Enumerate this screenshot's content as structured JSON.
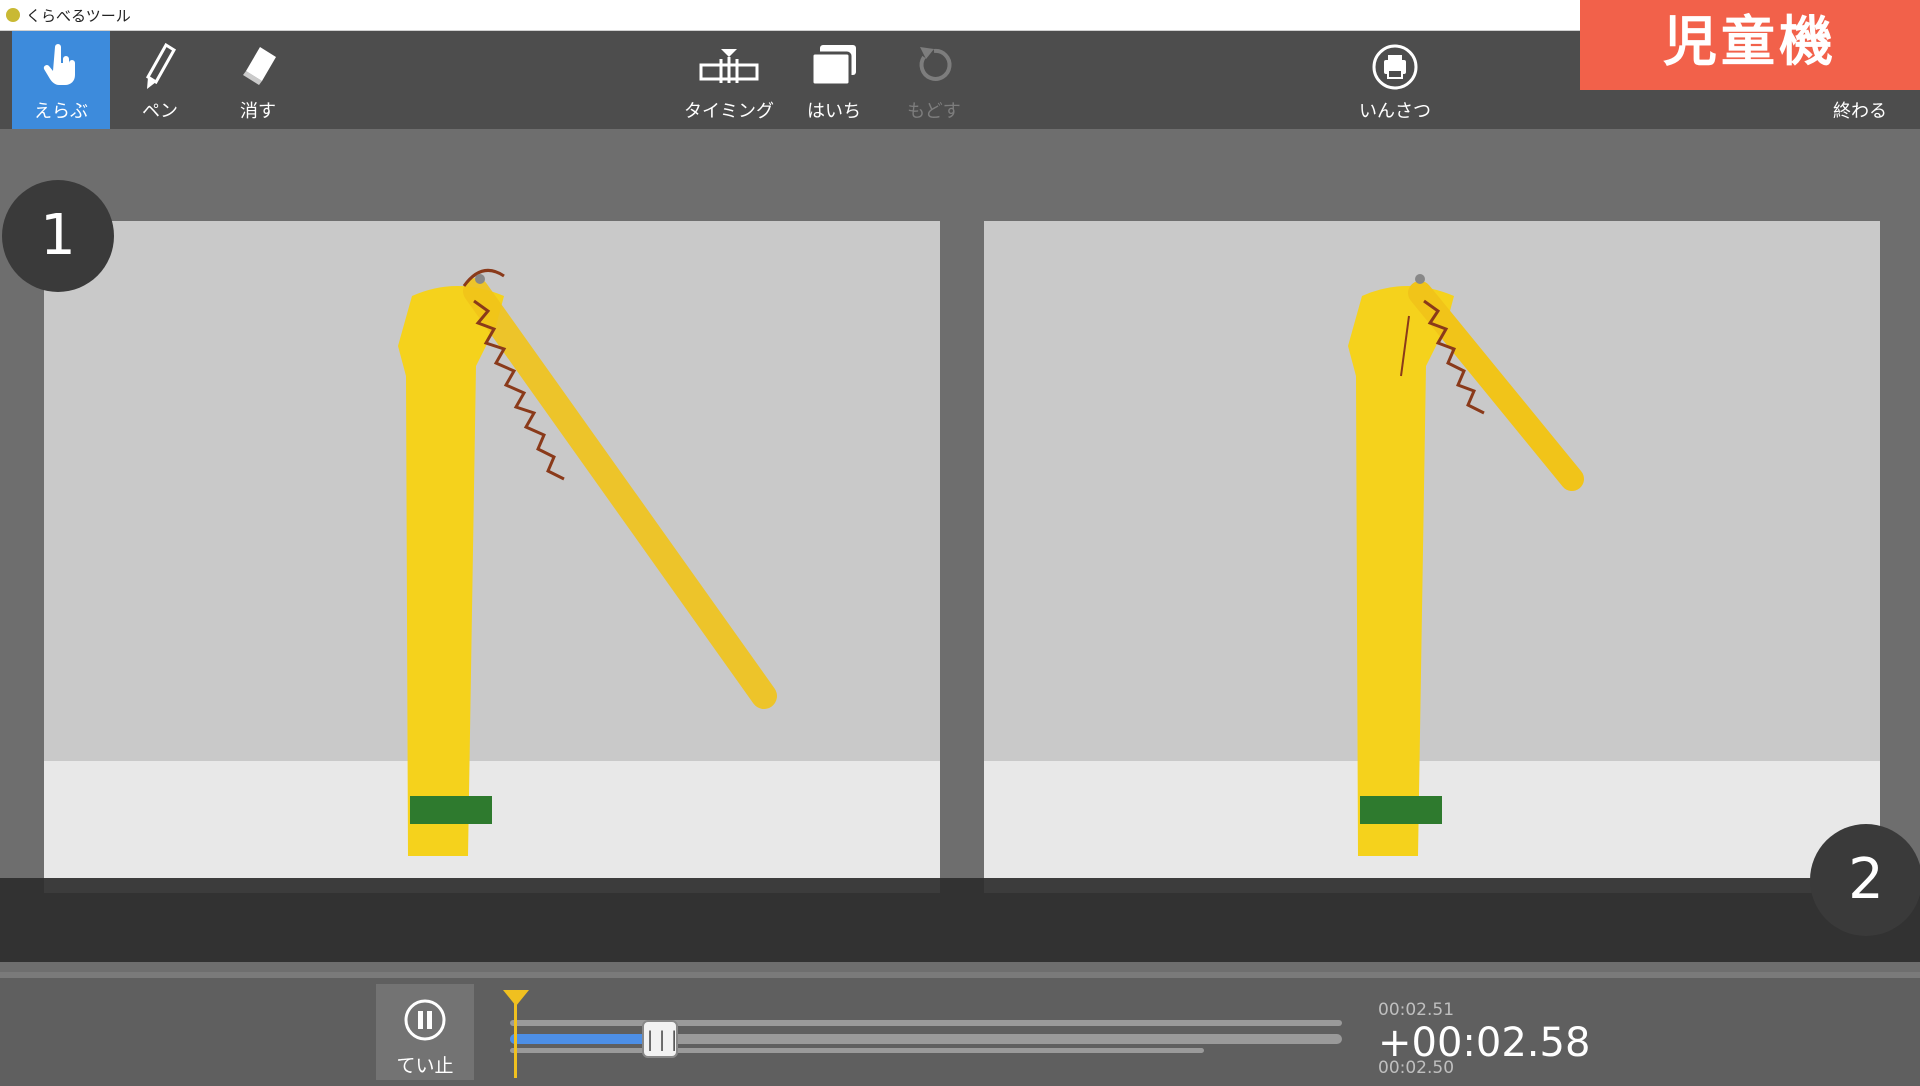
{
  "window": {
    "title": "くらべるツール"
  },
  "toolbar": {
    "select_label": "えらぶ",
    "pen_label": "ペン",
    "erase_label": "消す",
    "timing_label": "タイミング",
    "layout_label": "はいち",
    "undo_label": "もどす",
    "print_label": "いんさつ",
    "exit_label": "終わる"
  },
  "badge": {
    "label": "児童機"
  },
  "frames": {
    "left_number": "1",
    "right_number": "2"
  },
  "playback": {
    "pause_label": "てい止",
    "progress": 0.18,
    "time_upper": "00:02.51",
    "time_current": "+00:02.58",
    "time_lower": "00:02.50"
  },
  "colors": {
    "toolbar_bg": "#4d4d4d",
    "active_tool": "#3d8bdc",
    "badge": "#f2614a",
    "timeline_fill": "#4d8fe6",
    "marker": "#f0c020"
  }
}
